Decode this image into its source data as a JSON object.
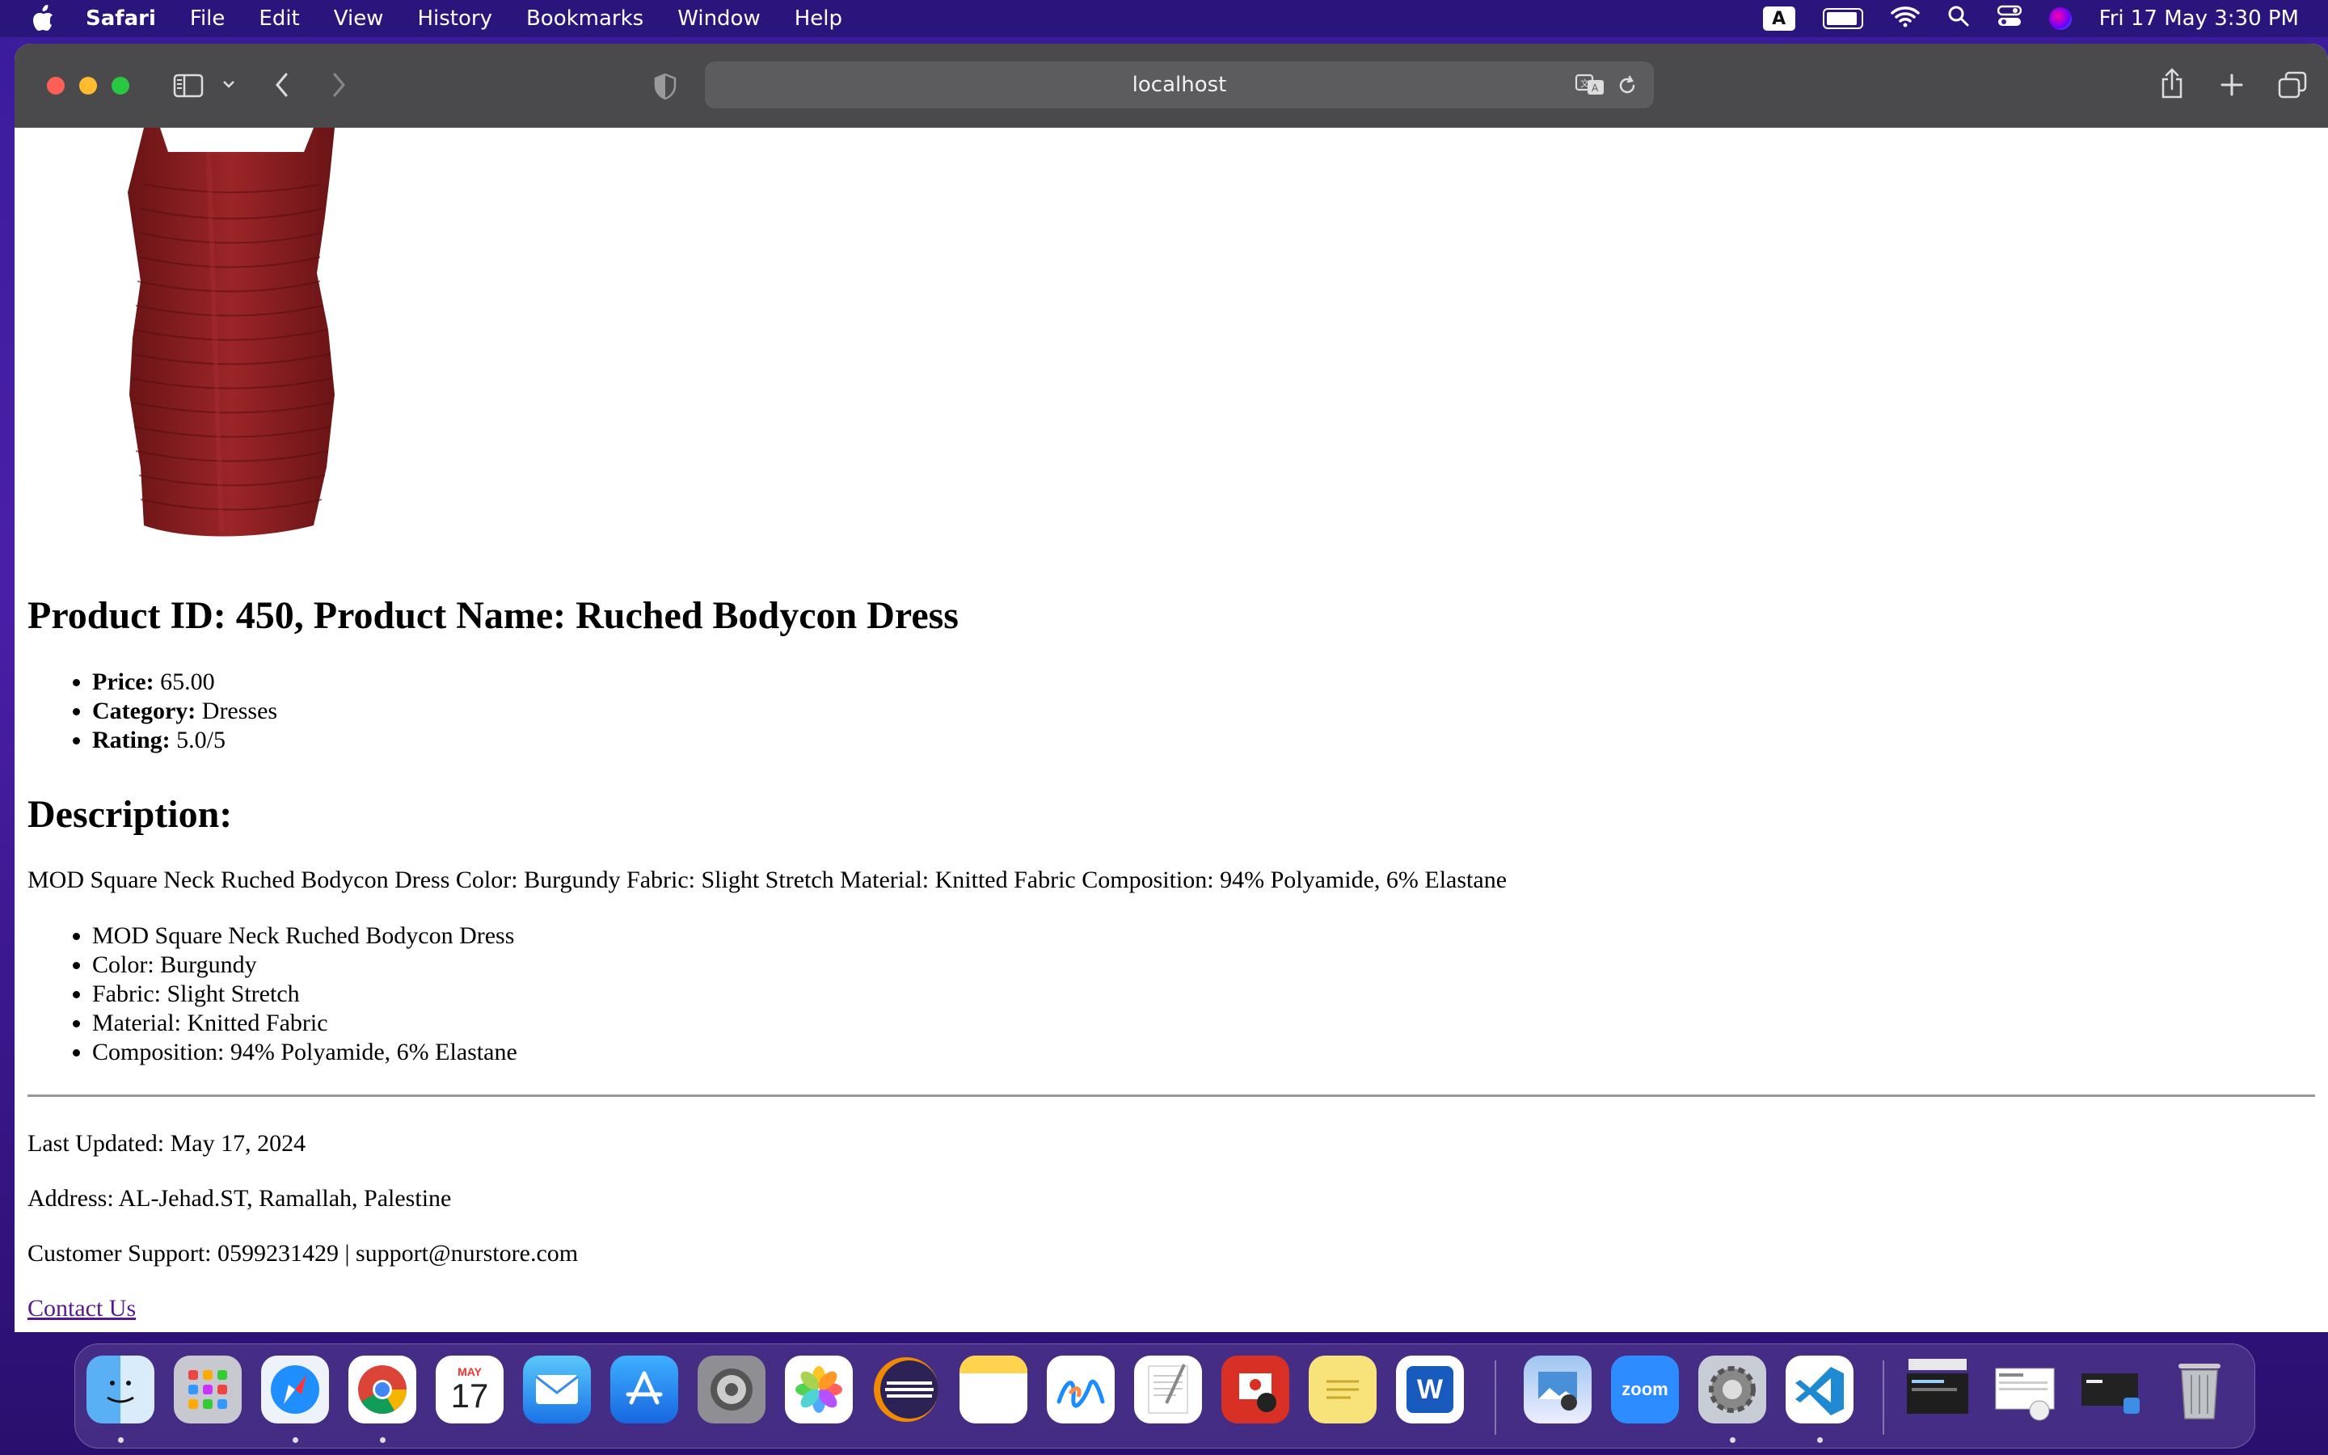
{
  "menubar": {
    "app": "Safari",
    "items": [
      "File",
      "Edit",
      "View",
      "History",
      "Bookmarks",
      "Window",
      "Help"
    ],
    "input_source": "A",
    "datetime": "Fri 17 May  3:30 PM"
  },
  "browser": {
    "url": "localhost"
  },
  "product": {
    "heading": "Product ID: 450, Product Name: Ruched Bodycon Dress",
    "price_label": "Price:",
    "price_value": "65.00",
    "category_label": "Category:",
    "category_value": "Dresses",
    "rating_label": "Rating:",
    "rating_value": "5.0/5",
    "image_alt": "red ruched bodycon dress",
    "dress_color": "#8e1f22"
  },
  "description": {
    "heading": "Description:",
    "text": "MOD Square Neck Ruched Bodycon Dress Color: Burgundy Fabric: Slight Stretch Material: Knitted Fabric Composition: 94% Polyamide, 6% Elastane",
    "features": [
      "MOD Square Neck Ruched Bodycon Dress",
      "Color: Burgundy",
      "Fabric: Slight Stretch",
      "Material: Knitted Fabric",
      "Composition: 94% Polyamide, 6% Elastane"
    ]
  },
  "footer": {
    "last_updated": "Last Updated: May 17, 2024",
    "address": "Address: AL-Jehad.ST, Ramallah, Palestine",
    "support": "Customer Support: 0599231429 | support@nurstore.com",
    "contact_link": "Contact Us"
  },
  "dock": {
    "calendar_month": "MAY",
    "calendar_day": "17",
    "zoom_label": "zoom",
    "word_label": "W",
    "apps": [
      "finder-icon",
      "launchpad-icon",
      "safari-icon",
      "chrome-icon",
      "calendar-icon",
      "mail-icon",
      "app-store-icon",
      "system-settings-icon",
      "photos-icon",
      "eclipse-icon",
      "notes-icon",
      "freeform-icon",
      "textedit-icon",
      "photo-booth-icon",
      "stickies-icon",
      "word-icon",
      "preview-icon",
      "zoom-icon",
      "system-preferences-icon",
      "vscode-icon",
      "trash-icon"
    ]
  }
}
